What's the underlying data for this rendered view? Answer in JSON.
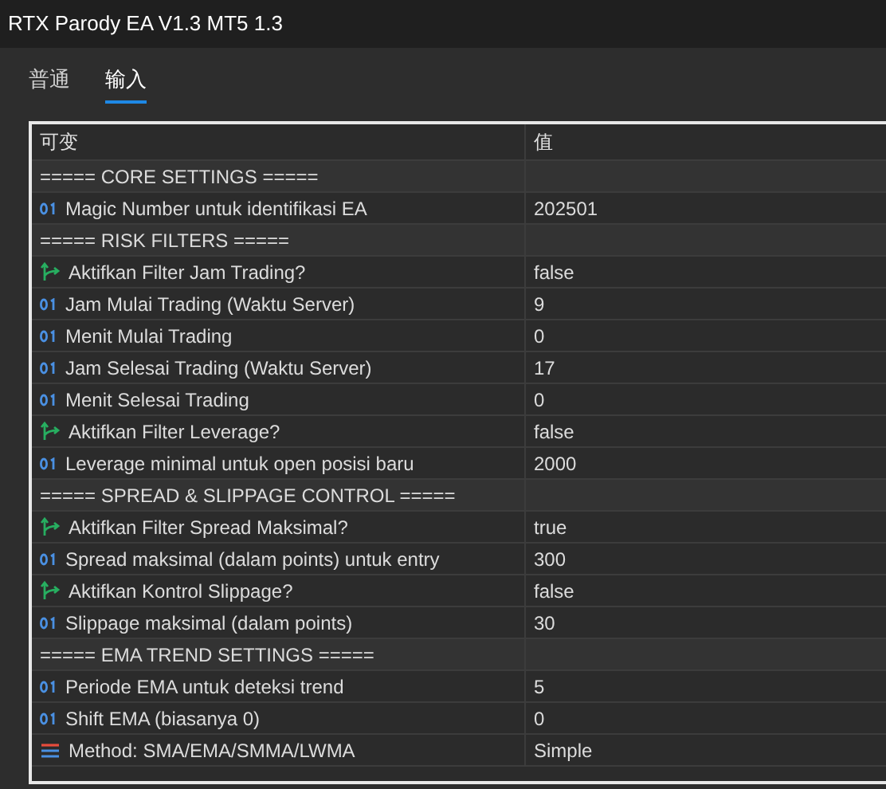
{
  "window": {
    "title": "RTX Parody EA V1.3 MT5 1.3"
  },
  "tabs": [
    {
      "label": "普通",
      "selected": false
    },
    {
      "label": "输入",
      "selected": true
    }
  ],
  "table": {
    "columns": [
      "可变",
      "值"
    ],
    "rows": [
      {
        "kind": "section",
        "name": "===== CORE SETTINGS ====="
      },
      {
        "kind": "int",
        "name": "Magic Number untuk identifikasi EA",
        "value": "202501"
      },
      {
        "kind": "section",
        "name": "===== RISK FILTERS ====="
      },
      {
        "kind": "bool",
        "name": "Aktifkan Filter Jam Trading?",
        "value": "false"
      },
      {
        "kind": "int",
        "name": "Jam Mulai Trading (Waktu Server)",
        "value": "9"
      },
      {
        "kind": "int",
        "name": "Menit Mulai Trading",
        "value": "0"
      },
      {
        "kind": "int",
        "name": "Jam Selesai Trading (Waktu Server)",
        "value": "17"
      },
      {
        "kind": "int",
        "name": "Menit Selesai Trading",
        "value": "0"
      },
      {
        "kind": "bool",
        "name": "Aktifkan Filter Leverage?",
        "value": "false"
      },
      {
        "kind": "int",
        "name": "Leverage minimal untuk open posisi baru",
        "value": "2000"
      },
      {
        "kind": "section",
        "name": "===== SPREAD & SLIPPAGE CONTROL ====="
      },
      {
        "kind": "bool",
        "name": "Aktifkan Filter Spread Maksimal?",
        "value": "true"
      },
      {
        "kind": "int",
        "name": "Spread maksimal (dalam points) untuk entry",
        "value": "300"
      },
      {
        "kind": "bool",
        "name": "Aktifkan Kontrol Slippage?",
        "value": "false"
      },
      {
        "kind": "int",
        "name": "Slippage maksimal (dalam points)",
        "value": "30"
      },
      {
        "kind": "section",
        "name": "===== EMA TREND SETTINGS ====="
      },
      {
        "kind": "int",
        "name": "Periode EMA untuk deteksi trend",
        "value": "5"
      },
      {
        "kind": "int",
        "name": "Shift EMA (biasanya 0)",
        "value": "0"
      },
      {
        "kind": "enum",
        "name": "Method: SMA/EMA/SMMA/LWMA",
        "value": "Simple"
      }
    ]
  }
}
